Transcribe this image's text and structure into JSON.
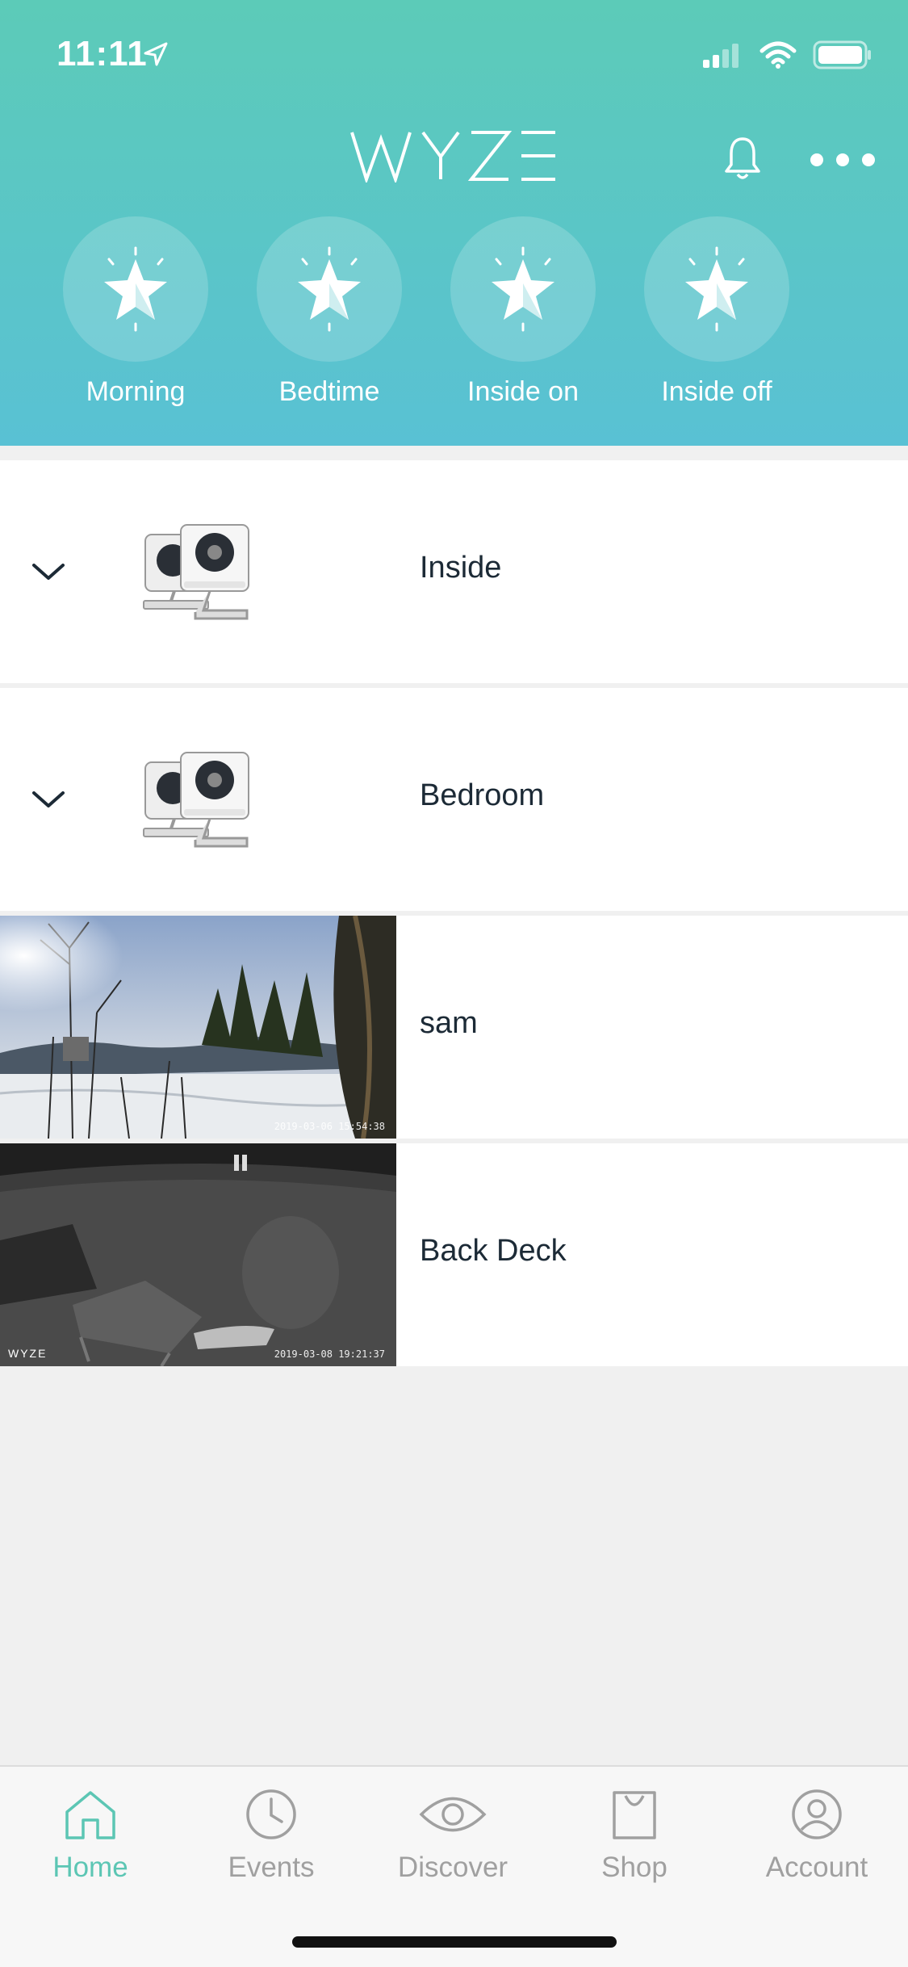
{
  "status_bar": {
    "time": "11:11"
  },
  "header": {
    "logo_text": "WYZE",
    "shortcuts": [
      {
        "label": "Morning",
        "icon": "star-icon"
      },
      {
        "label": "Bedtime",
        "icon": "star-icon"
      },
      {
        "label": "Inside on",
        "icon": "star-icon"
      },
      {
        "label": "Inside off",
        "icon": "star-icon"
      }
    ]
  },
  "devices": [
    {
      "name": "Inside",
      "type": "group",
      "icon": "camera-group-icon"
    },
    {
      "name": "Bedroom",
      "type": "group",
      "icon": "camera-group-icon"
    },
    {
      "name": "sam",
      "type": "camera",
      "timestamp": "2019-03-06 15:54:38"
    },
    {
      "name": "Back Deck",
      "type": "camera",
      "timestamp": "2019-03-08 19:21:37",
      "watermark": "WYZE"
    }
  ],
  "tabbar": {
    "active": "Home",
    "tabs": [
      {
        "label": "Home",
        "icon": "home-icon"
      },
      {
        "label": "Events",
        "icon": "clock-icon"
      },
      {
        "label": "Discover",
        "icon": "eye-icon"
      },
      {
        "label": "Shop",
        "icon": "shopping-bag-icon"
      },
      {
        "label": "Account",
        "icon": "account-icon"
      }
    ]
  },
  "colors": {
    "accent": "#5cc6b4",
    "header_top": "#5ccbb8",
    "header_bottom": "#59c1d4",
    "inactive": "#a0a0a0"
  }
}
